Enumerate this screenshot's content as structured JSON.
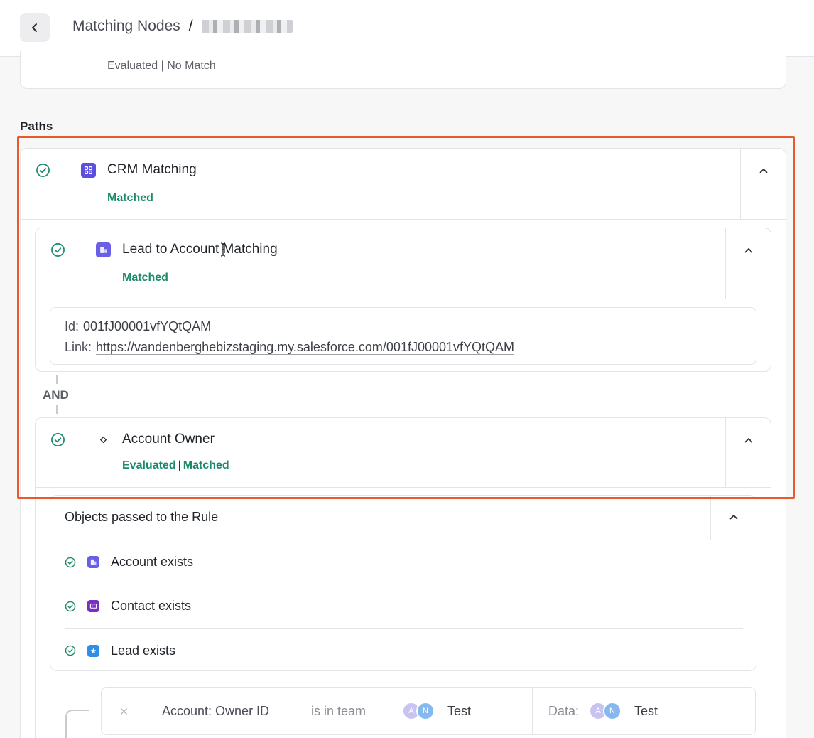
{
  "header": {
    "title": "Matching Nodes",
    "separator": "/"
  },
  "top_card": {
    "status": "Evaluated | No Match"
  },
  "paths_label": "Paths",
  "crm_matching": {
    "title": "CRM Matching",
    "status": "Matched"
  },
  "lead_to_account": {
    "title": "Lead to Account Matching",
    "status": "Matched",
    "id_label": "Id:",
    "id_value": "001fJ00001vfYQtQAM",
    "link_label": "Link:",
    "link_value": "https://vandenberghebizstaging.my.salesforce.com/001fJ00001vfYQtQAM"
  },
  "and_label": "AND",
  "account_owner": {
    "title": "Account Owner",
    "status_a": "Evaluated",
    "status_sep": "|",
    "status_b": "Matched"
  },
  "objects": {
    "title": "Objects passed to the Rule",
    "items": [
      {
        "label": "Account exists",
        "icon": "account-icon"
      },
      {
        "label": "Contact exists",
        "icon": "contact-icon"
      },
      {
        "label": "Lead exists",
        "icon": "lead-icon"
      }
    ]
  },
  "condition": {
    "field": "Account: Owner ID",
    "operator": "is in team",
    "value_avatar_a": "A",
    "value_avatar_n": "N",
    "value_name": "Test",
    "data_label": "Data:",
    "data_avatar_a": "A",
    "data_avatar_n": "N",
    "data_name": "Test"
  },
  "colors": {
    "accent_green": "#1a8a6b",
    "highlight": "#e8592c",
    "badge_purple": "#5c4fe0"
  }
}
